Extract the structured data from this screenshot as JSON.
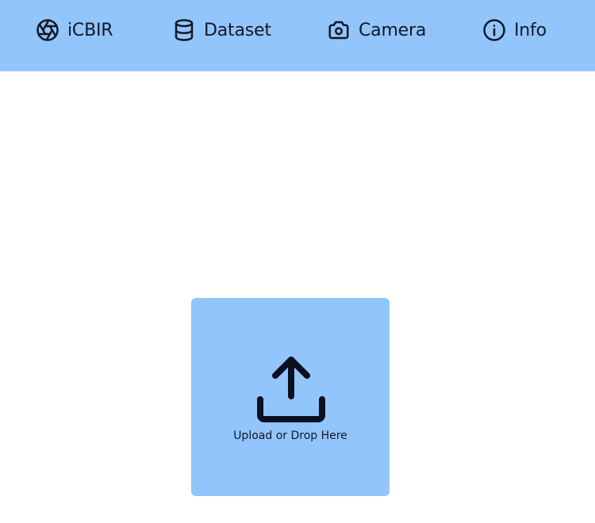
{
  "nav": {
    "items": [
      {
        "label": "iCBIR",
        "icon": "aperture-icon"
      },
      {
        "label": "Dataset",
        "icon": "database-icon"
      },
      {
        "label": "Camera",
        "icon": "camera-icon"
      },
      {
        "label": "Info",
        "icon": "info-icon"
      }
    ]
  },
  "dropzone": {
    "label": "Upload or Drop Here",
    "icon": "upload-icon"
  },
  "colors": {
    "accent": "#93c5fd",
    "text": "#111827",
    "background": "#ffffff"
  }
}
